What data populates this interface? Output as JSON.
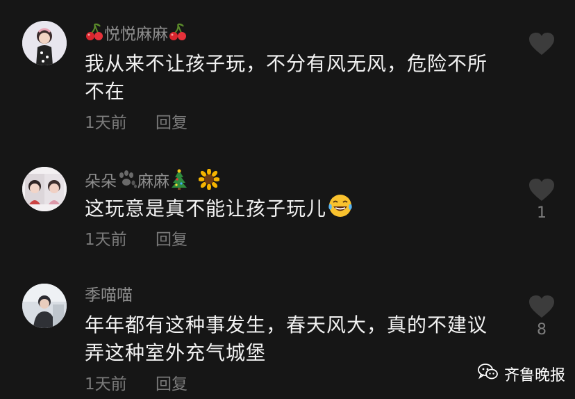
{
  "comments": [
    {
      "username": "悦悦麻麻",
      "username_emoji_left": "cherries-icon",
      "username_emoji_right": "cherries-icon",
      "text": "我从来不让孩子玩，不分有风无风，危险不所不在",
      "time": "1天前",
      "reply_label": "回复",
      "like_count": ""
    },
    {
      "username_part1": "朵朵",
      "username_emoji_paw": "paw-icon",
      "username_part2": "麻麻",
      "username_emoji_tree": "christmas-tree-icon",
      "username_emoji_sunflower": "sunflower-icon",
      "text": "这玩意是真不能让孩子玩儿",
      "text_emoji": "laughing-crying-emoji",
      "time": "1天前",
      "reply_label": "回复",
      "like_count": "1"
    },
    {
      "username": "季喵喵",
      "text": "年年都有这种事发生，春天风大，真的不建议弄这种室外充气城堡",
      "time": "1天前",
      "reply_label": "回复",
      "like_count": "8"
    }
  ],
  "watermark": {
    "label": "齐鲁晚报",
    "icon": "wechat-icon"
  },
  "colors": {
    "background": "#161616",
    "text": "#f2f2f2",
    "muted": "#7a7a7a"
  }
}
